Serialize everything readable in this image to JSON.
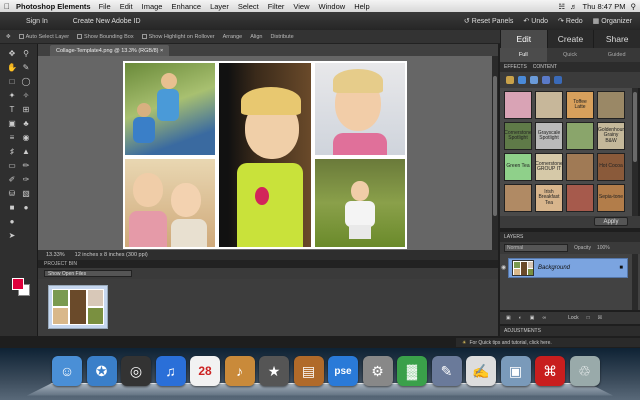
{
  "mac_menubar": {
    "app_name": "Photoshop Elements",
    "menus": [
      "File",
      "Edit",
      "Image",
      "Enhance",
      "Layer",
      "Select",
      "Filter",
      "View",
      "Window",
      "Help"
    ],
    "clock": "Thu 8:47 PM"
  },
  "topbar": {
    "sign_in": "Sign In",
    "create_id": "Create New Adobe ID",
    "reset_panels": "Reset Panels",
    "undo": "Undo",
    "redo": "Redo",
    "organizer": "Organizer"
  },
  "options_bar": {
    "auto_select": "Auto Select Layer",
    "bounding_box": "Show Bounding Box",
    "highlight": "Show Highlight on Rollover",
    "arrange": "Arrange",
    "align": "Align",
    "distribute": "Distribute"
  },
  "mode_tabs": [
    {
      "label": "Edit",
      "active": true
    },
    {
      "label": "Create",
      "active": false
    },
    {
      "label": "Share",
      "active": false
    }
  ],
  "sub_tabs": [
    {
      "label": "Full",
      "active": true
    },
    {
      "label": "Quick",
      "active": false
    },
    {
      "label": "Guided",
      "active": false
    }
  ],
  "document": {
    "tab_title": "Collage-Template4.png @ 13.3% (RGB/8) ×",
    "zoom": "13.33%",
    "doc_size": "12 inches x 8 inches (300 ppi)"
  },
  "project_bin": {
    "header": "PROJECT BIN",
    "selector": "Show Open Files"
  },
  "effects_panel": {
    "header_effects": "EFFECTS",
    "header_content": "CONTENT",
    "apply_label": "Apply",
    "tiles": [
      {
        "label": "",
        "color": "#d9a3b5"
      },
      {
        "label": "",
        "color": "#c7b79a"
      },
      {
        "label": "Toffee Latte",
        "color": "#d7a05c"
      },
      {
        "label": "",
        "color": "#9a8866"
      },
      {
        "label": "Cornerstone Spotlight",
        "color": "#5f7a48"
      },
      {
        "label": "Grayscale Spotlight",
        "color": "#b9b9b9"
      },
      {
        "label": "",
        "color": "#8aa56b"
      },
      {
        "label": "Goldenhour Grainy B&W",
        "color": "#c4b89a"
      },
      {
        "label": "Green Tea",
        "color": "#8fd08a"
      },
      {
        "label": "Cornerstone GROUP IT",
        "color": "#d6c9a8"
      },
      {
        "label": "",
        "color": "#a07a55"
      },
      {
        "label": "Hot Cocoa",
        "color": "#8a5a3a"
      },
      {
        "label": "",
        "color": "#b08a64"
      },
      {
        "label": "Irish Breakfast Tea",
        "color": "#d8b58c"
      },
      {
        "label": "",
        "color": "#a65a4c"
      },
      {
        "label": "Sepia-tone",
        "color": "#b27d4a"
      }
    ]
  },
  "layers_panel": {
    "header": "LAYERS",
    "blend_mode": "Normal",
    "opacity_label": "Opacity",
    "opacity_value": "100%",
    "layer_name": "Background",
    "lock_label": "Lock"
  },
  "adjustments_header": "ADJUSTMENTS",
  "tip_text": "For Quick tips and tutorial, click here.",
  "dock": [
    {
      "name": "finder-icon",
      "glyph": "☺",
      "color": "#4a8fd6"
    },
    {
      "name": "safari-icon",
      "glyph": "✪",
      "color": "#3a7fc9"
    },
    {
      "name": "dashboard-icon",
      "glyph": "◎",
      "color": "#333333"
    },
    {
      "name": "itunes-icon",
      "glyph": "♫",
      "color": "#2a6fd8"
    },
    {
      "name": "ical-icon",
      "glyph": "28",
      "color": "#f2f2f2"
    },
    {
      "name": "garageband-icon",
      "glyph": "♪",
      "color": "#c98a3a"
    },
    {
      "name": "imovie-icon",
      "glyph": "★",
      "color": "#555555"
    },
    {
      "name": "presentation-icon",
      "glyph": "▤",
      "color": "#b06a2a"
    },
    {
      "name": "pse-icon",
      "glyph": "pse",
      "color": "#2a7ad8"
    },
    {
      "name": "preferences-icon",
      "glyph": "⚙",
      "color": "#888888"
    },
    {
      "name": "numbers-icon",
      "glyph": "▓",
      "color": "#3aa04a"
    },
    {
      "name": "quill-icon",
      "glyph": "✎",
      "color": "#6a7a9a"
    },
    {
      "name": "textedit-icon",
      "glyph": "✍",
      "color": "#dddddd"
    },
    {
      "name": "preview-icon",
      "glyph": "▣",
      "color": "#7a9aba"
    },
    {
      "name": "acrobat-icon",
      "glyph": "⌘",
      "color": "#c81e1e"
    },
    {
      "name": "trash-icon",
      "glyph": "♲",
      "color": "#9aa"
    }
  ]
}
